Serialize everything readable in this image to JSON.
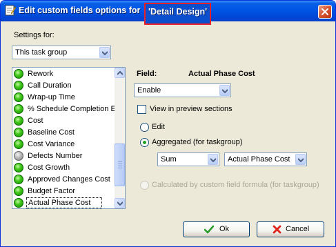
{
  "title": {
    "prefix": "Edit custom fields options for",
    "highlight": "'Detail Design'"
  },
  "settings": {
    "label": "Settings for:",
    "value": "This task group"
  },
  "list": {
    "items": [
      {
        "label": "Rework",
        "status": "green"
      },
      {
        "label": "Call Duration",
        "status": "green"
      },
      {
        "label": "Wrap-up Time",
        "status": "green"
      },
      {
        "label": "% Schedule Completion El",
        "status": "green"
      },
      {
        "label": "Cost",
        "status": "green"
      },
      {
        "label": "Baseline Cost",
        "status": "green"
      },
      {
        "label": "Cost Variance",
        "status": "green"
      },
      {
        "label": "Defects Number",
        "status": "gray"
      },
      {
        "label": "Cost Growth",
        "status": "green"
      },
      {
        "label": "Approved Changes Cost",
        "status": "green"
      },
      {
        "label": "Budget Factor",
        "status": "green"
      },
      {
        "label": "Actual Phase Cost",
        "status": "green"
      }
    ],
    "selected": "Actual Phase Cost"
  },
  "field": {
    "label": "Field:",
    "name": "Actual Phase Cost",
    "enable_value": "Enable",
    "view_preview_label": "View in preview sections",
    "view_preview_checked": false,
    "edit_label": "Edit",
    "aggregated_label": "Aggregated (for taskgroup)",
    "aggregated_selected": true,
    "agg_function": "Sum",
    "agg_source": "Actual Phase Cost",
    "calculated_label": "Calculated by custom field formula (for taskgroup)"
  },
  "buttons": {
    "ok": "Ok",
    "cancel": "Cancel"
  },
  "colors": {
    "title_bar": "#0055e5",
    "highlight_border": "#e8202a",
    "status_green": "#41c81a",
    "status_gray": "#b8b8b8",
    "radio_dot": "#21a121"
  }
}
